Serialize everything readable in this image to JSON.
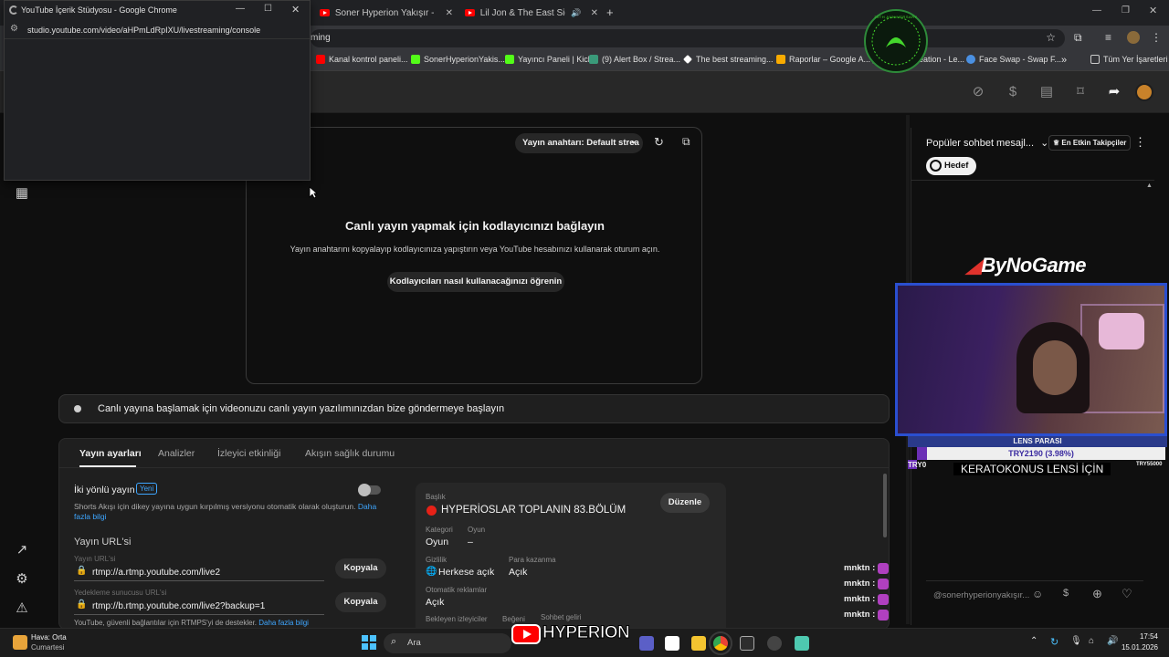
{
  "browser": {
    "tabs": [
      {
        "label": "Soner Hyperion Yakışır - YouTub"
      },
      {
        "label": "Lil Jon & The East Side Boy"
      }
    ],
    "address_fragment": "ming",
    "bookmarks": [
      "Kanal kontrol paneli...",
      "SonerHyperionYakis...",
      "Yayıncı Paneli | Kick",
      "(9) Alert Box / Strea...",
      "The best streaming...",
      "Raporlar – Google A...",
      "Image Creation - Le...",
      "Face Swap - Swap F...",
      "Tüm Yer İşaretleri"
    ],
    "more_bookmarks": "»",
    "badge_text": "20TH ANNIVERSARY"
  },
  "popup": {
    "title": "YouTube İçerik Stüdyosu - Google Chrome",
    "url": "studio.youtube.com/video/aHPmLdRpIXU/livestreaming/console"
  },
  "preview": {
    "stream_key_label": "Yayın anahtarı: Default strea",
    "heading": "Canlı yayın yapmak için kodlayıcınızı bağlayın",
    "subtitle": "Yayın anahtarını kopyalayıp kodlayıcınıza yapıştırın veya YouTube hesabınızı kullanarak oturum açın.",
    "learn_button": "Kodlayıcıları nasıl kullanacağınızı öğrenin"
  },
  "status": {
    "message": "Canlı yayına başlamak için videonuzu canlı yayın yazılımınızdan bize göndermeye başlayın"
  },
  "settings": {
    "tabs": [
      "Yayın ayarları",
      "Analizler",
      "İzleyici etkinliği",
      "Akışın sağlık durumu"
    ],
    "two_way_label": "İki yönlü yayın",
    "new_badge": "Yeni",
    "two_way_desc": "Shorts Akışı için dikey yayına uygun kırpılmış versiyonu otomatik olarak oluşturun.",
    "more_info": "Daha fazla bilgi",
    "url_section": "Yayın URL'si",
    "url_label": "Yayın URL'si",
    "url_value": "rtmp://a.rtmp.youtube.com/live2",
    "backup_label": "Yedekleme sunucusu URL'si",
    "backup_value": "rtmp://b.rtmp.youtube.com/live2?backup=1",
    "copy_button": "Kopyala",
    "rtmps_note": "YouTube, güvenli bağlantılar için RTMPS'yi de destekler.",
    "more_info2": "Daha fazla bilgi",
    "title_label": "Başlık",
    "title_value": "HYPERİOSLAR TOPLANIN 83.BÖLÜM",
    "edit_button": "Düzenle",
    "category_label": "Kategori",
    "category_value": "Oyun",
    "game_label": "Oyun",
    "game_value": "–",
    "privacy_label": "Gizlilik",
    "privacy_value": "Herkese açık",
    "monetization_label": "Para kazanma",
    "monetization_value": "Açık",
    "auto_ads_label": "Otomatik reklamlar",
    "auto_ads_value": "Açık",
    "waiting_label": "Bekleyen izleyiciler",
    "likes_label": "Beğeni",
    "chat_label": "Sohbet geliri"
  },
  "chat": {
    "header": "Popüler sohbet mesajl...",
    "top_fans_label": "En Etkin Takipçiler",
    "goal_button": "Hedef",
    "input_placeholder": "@sonerhyperionyakışır...",
    "users": [
      "mnktn :",
      "mnktn :",
      "mnktn :",
      "mnktn :"
    ]
  },
  "overlay": {
    "sponsor": "ByNoGame",
    "lens_title": "LENS PARASI",
    "lens_progress": "TRY2190 (3.98%)",
    "lens_progress_fraction": 0.0398,
    "lens_min": "TRY0",
    "lens_max": "TRY55000",
    "lens_caption": "KERATOKONUS LENSİ İÇİN",
    "logo_text": "HYPERION"
  },
  "taskbar": {
    "weather_line1": "Hava: Orta",
    "weather_line2": "Cumartesi",
    "search_label": "Ara",
    "time": "17:54",
    "date": "15.01.2026"
  },
  "colors": {
    "youtube_red": "#ff0000",
    "link_blue": "#3ea6ff",
    "record_red": "#e62117"
  }
}
